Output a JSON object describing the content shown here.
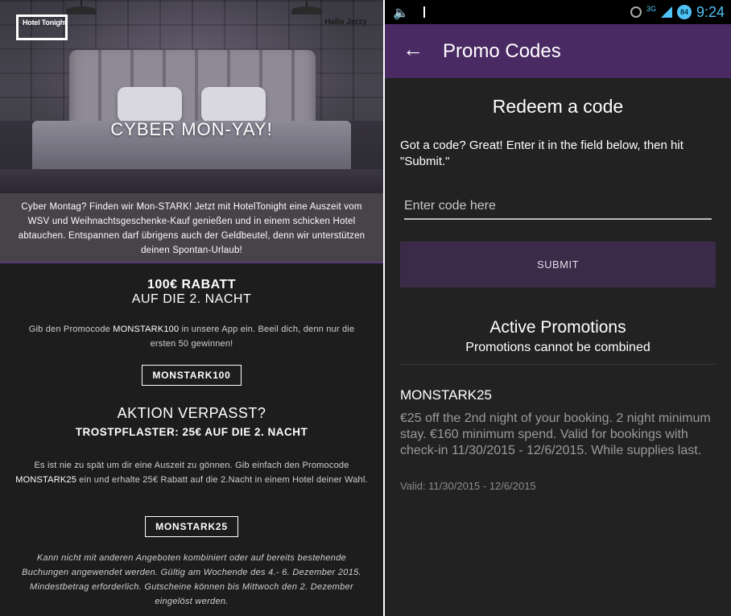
{
  "email": {
    "logo_text": "Hotel Tonight",
    "greeting": "Hallo Jerzy",
    "hero_title": "CYBER MON-YAY!",
    "intro": "Cyber Montag? Finden wir Mon-STARK! Jetzt mit HotelTonight eine Auszeit vom WSV und Weihnachtsgeschenke-Kauf genießen und in einem schicken Hotel abtauchen. Entspannen darf übrigens auch der Geldbeutel, denn wir unterstützen deinen Spontan-Urlaub!",
    "offer1": {
      "title": "100€ RABATT",
      "subtitle": "AUF DIE 2. NACHT",
      "text_before": "Gib den Promocode ",
      "code_inline": "MONSTARK100",
      "text_after": " in unsere App ein. Beeil dich, denn nur die ersten 50 gewinnen!",
      "code_button": "MONSTARK100"
    },
    "offer2": {
      "title": "AKTION VERPASST?",
      "subtitle": "TROSTPFLASTER: 25€ AUF DIE 2. NACHT",
      "text_before": "Es ist nie zu spät um dir eine Auszeit zu gönnen. Gib einfach den Promocode ",
      "code_inline": "MONSTARK25",
      "text_after": " ein und erhalte 25€ Rabatt auf die 2.Nacht in einem Hotel deiner Wahl.",
      "code_button": "MONSTARK25"
    },
    "footnote": "Kann nicht mit anderen Angeboten kombiniert oder auf bereits bestehende Buchungen angewendet werden. Gültig am Wochende des 4.- 6. Dezember 2015. Mindestbetrag erforderlich. Gutscheine können bis Mittwoch den 2. Dezember eingelöst werden."
  },
  "app": {
    "status_bar": {
      "network": "3G",
      "battery": "84",
      "time": "9:24"
    },
    "appbar": {
      "title": "Promo Codes"
    },
    "redeem_title": "Redeem a code",
    "instructions": "Got a code? Great! Enter it in the field below, then hit \"Submit.\"",
    "input_placeholder": "Enter code here",
    "submit_label": "SUBMIT",
    "active_title": "Active Promotions",
    "active_subtitle": "Promotions cannot be combined",
    "promotions": [
      {
        "code": "MONSTARK25",
        "description": "€25 off the 2nd night of your booking. 2 night minimum stay. €160 minimum spend. Valid for bookings with check-in 11/30/2015 - 12/6/2015. While supplies last.",
        "valid": "Valid: 11/30/2015 - 12/6/2015"
      }
    ]
  }
}
